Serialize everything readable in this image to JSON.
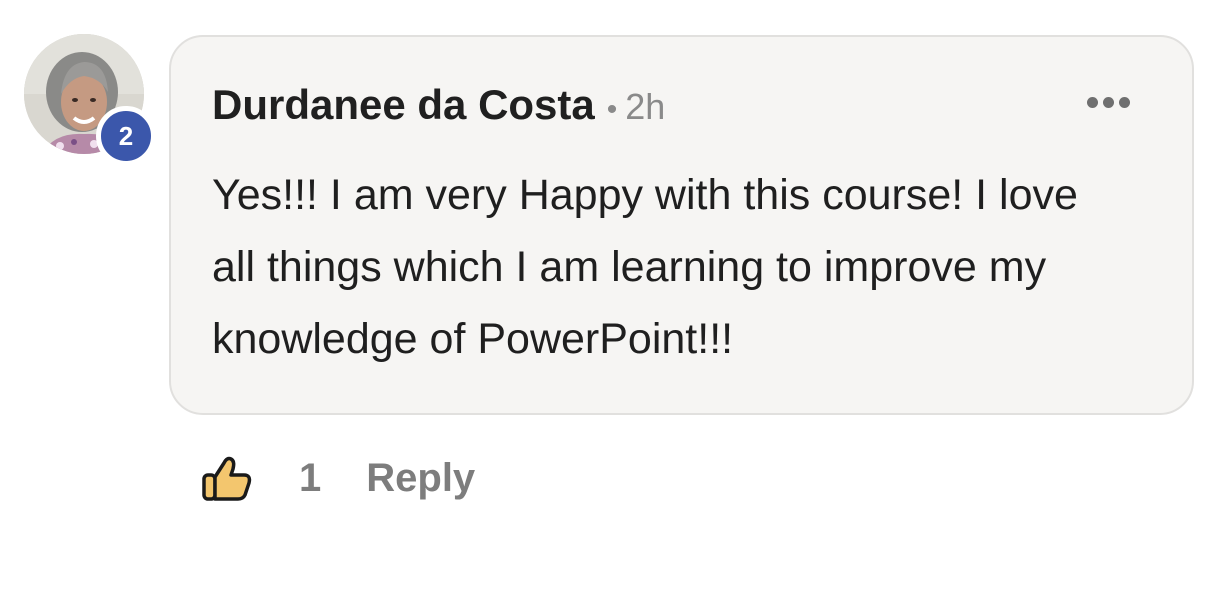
{
  "comment": {
    "author": "Durdanee da Costa",
    "separator": "•",
    "timestamp": "2h",
    "level_badge": "2",
    "text": "Yes!!! I am very Happy with this course! I love all things which I am learning to improve my knowledge of PowerPoint!!!",
    "like_count": "1",
    "reply_label": "Reply"
  },
  "icons": {
    "like": "thumbs-up-icon",
    "more": "more-options-icon"
  },
  "colors": {
    "badge": "#3b57ab",
    "bubble_bg": "#f6f5f3",
    "bubble_border": "#e1e0de",
    "like_fill": "#f3c66e",
    "muted_text": "#7d7d7d"
  }
}
